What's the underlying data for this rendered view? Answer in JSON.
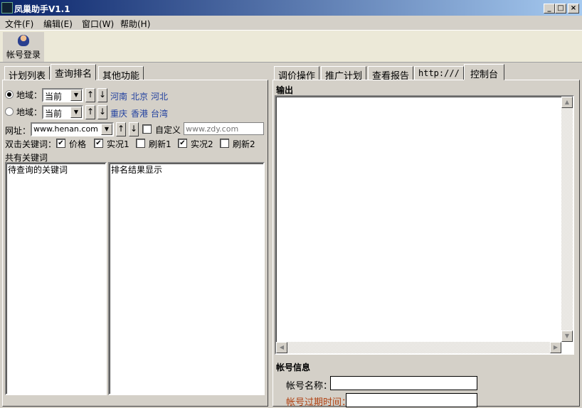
{
  "window": {
    "title": "凤巢助手V1.1",
    "min": "_",
    "max": "□",
    "close": "×"
  },
  "menu": [
    "文件(F)",
    "编辑(E)",
    "窗口(W)",
    "帮助(H)"
  ],
  "toolbar": {
    "login_label": "帐号登录"
  },
  "left_tabs": [
    "计划列表",
    "查询排名",
    "其他功能"
  ],
  "right_tabs": [
    "调价操作",
    "推广计划",
    "查看报告",
    "http:///",
    "控制台"
  ],
  "query": {
    "region_label": "地域：",
    "region1": {
      "value": "当前",
      "links": [
        "河南",
        "北京",
        "河北"
      ],
      "selected": true
    },
    "region2": {
      "value": "当前",
      "links": [
        "重庆",
        "香港",
        "台湾"
      ],
      "selected": false
    },
    "url_label": "网址：",
    "url_value": "www.henan.com",
    "custom_label": "自定义",
    "custom_placeholder": "www.zdy.com",
    "dblclick_label": "双击关键词：",
    "checks": [
      {
        "label": "价格",
        "checked": true
      },
      {
        "label": "实况1",
        "checked": true
      },
      {
        "label": "刷新1",
        "checked": false
      },
      {
        "label": "实况2",
        "checked": true
      },
      {
        "label": "刷新2",
        "checked": false
      }
    ],
    "keywords_label": "共有关键词",
    "pending_list": "待查询的关键词",
    "result_list": "排名结果显示"
  },
  "console": {
    "output_label": "输出",
    "account_info": "帐号信息",
    "account_name_label": "帐号名称：",
    "expire_label": "帐号过期时间："
  },
  "colors": {
    "link": "#1f3f9f",
    "expire_label": "#b04010"
  }
}
